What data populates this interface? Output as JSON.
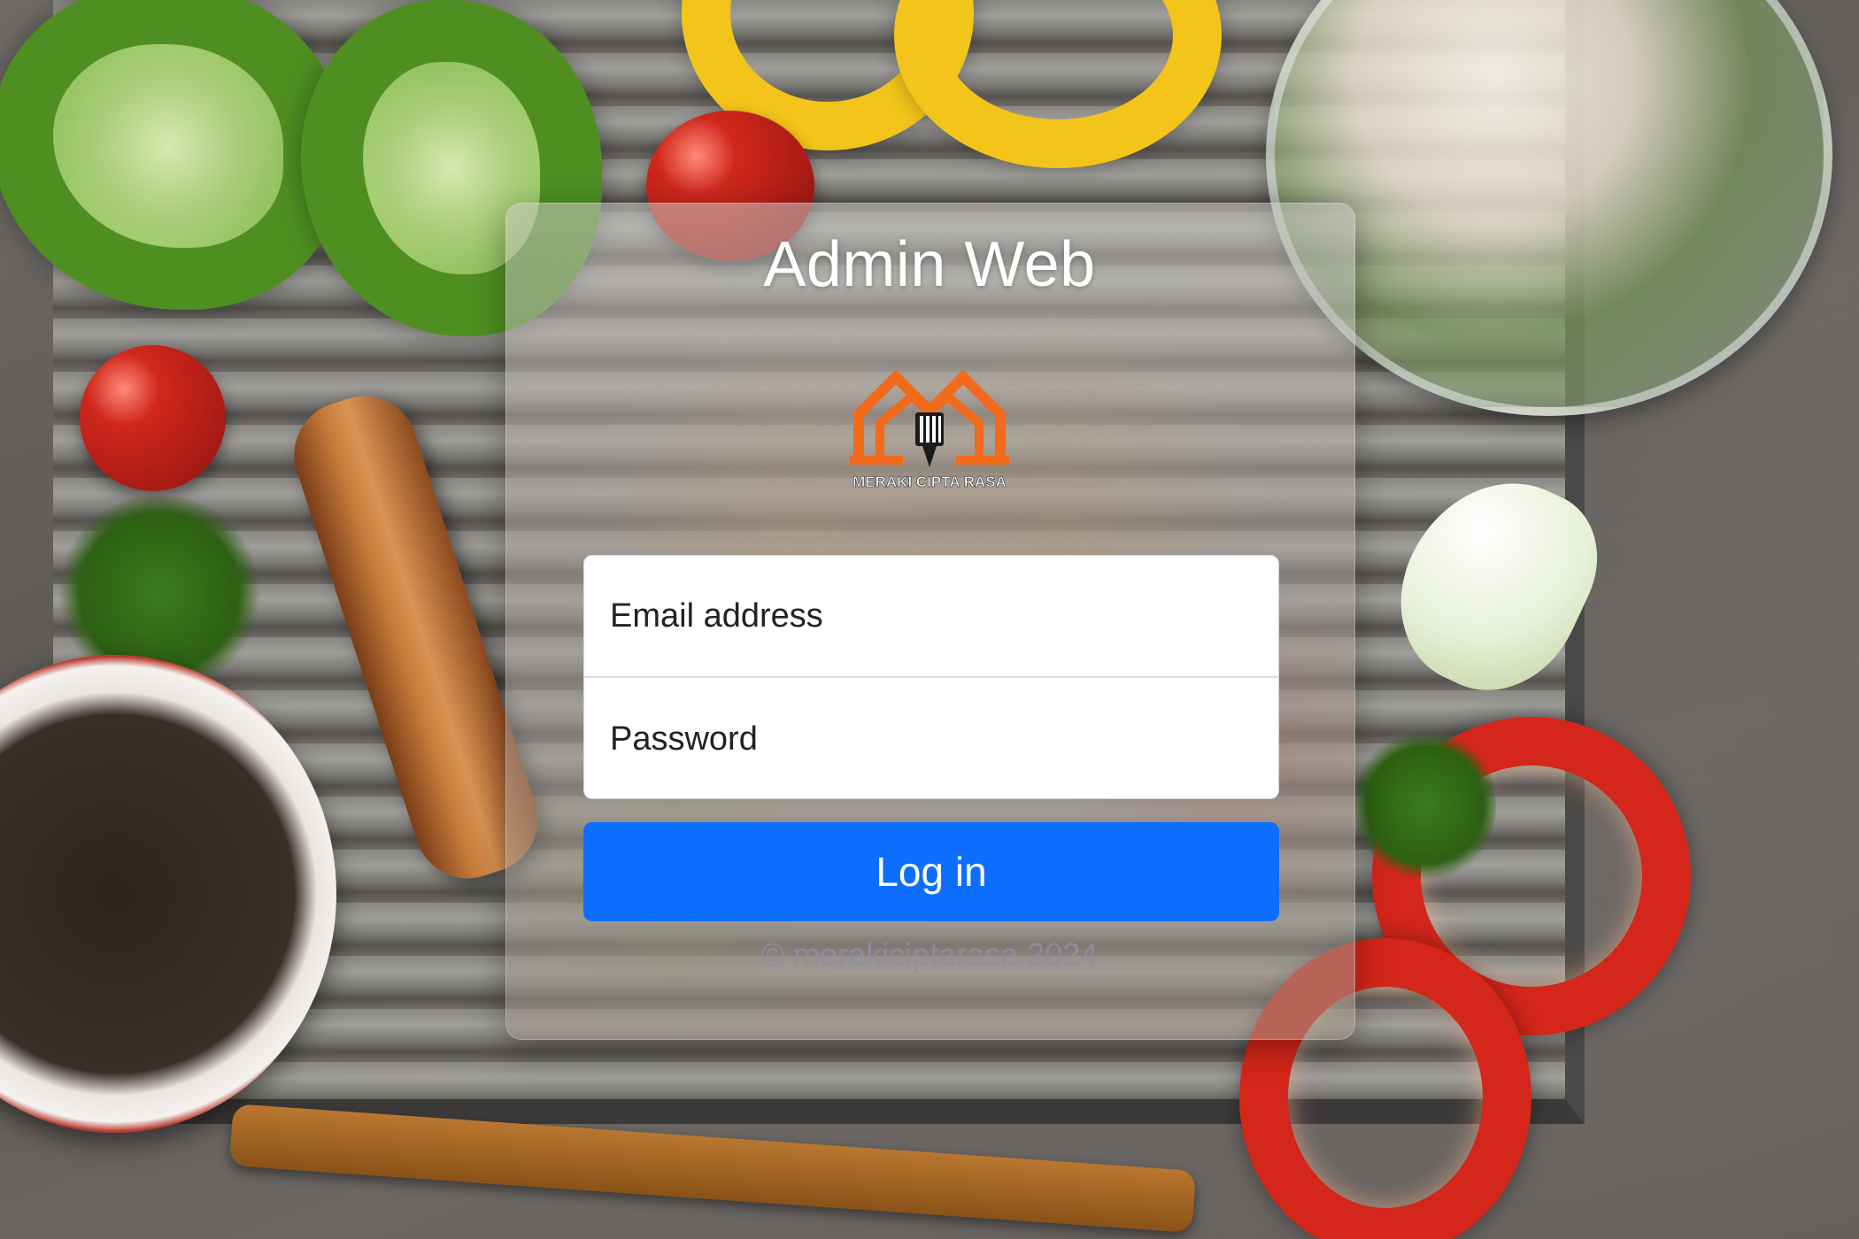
{
  "login": {
    "title": "Admin Web",
    "logo_text": "MERAKI CIPTA RASA",
    "email_placeholder": "Email address",
    "password_placeholder": "Password",
    "submit_label": "Log in",
    "footer": "© merakiciptarasa 2024"
  },
  "colors": {
    "primary_button": "#0d6efd",
    "logo_orange": "#f26a1b",
    "title_text": "#ffffff"
  }
}
